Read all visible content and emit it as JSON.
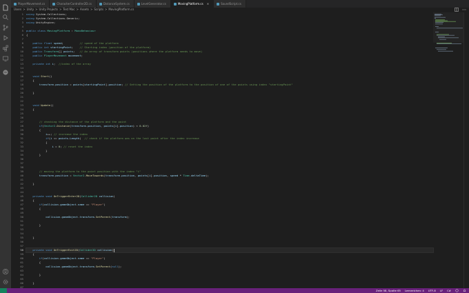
{
  "tabs": [
    {
      "label": "PlayerMovement.cs",
      "active": false
    },
    {
      "label": "CharacterController2D.cs",
      "active": false
    },
    {
      "label": "DistanceSystem.cs",
      "active": false
    },
    {
      "label": "LevelGenerator.cs",
      "active": false
    },
    {
      "label": "MovingPlatform.cs",
      "active": true,
      "close": "×"
    },
    {
      "label": "SoundScript.cs",
      "active": false
    }
  ],
  "breadcrumb": [
    "Users",
    "Unity",
    "Unity Projects",
    "Test Mac",
    "Assets",
    "Scripts",
    "MovingPlatform.cs"
  ],
  "breadcrumb_sep": ">",
  "code": {
    "current_line": 58,
    "lines": [
      [
        [
          "k",
          "using "
        ],
        [
          "t",
          "System.Collections"
        ],
        [
          "p",
          ";"
        ]
      ],
      [
        [
          "k",
          "using "
        ],
        [
          "t",
          "System.Collections.Generic"
        ],
        [
          "p",
          ";"
        ]
      ],
      [
        [
          "k",
          "using "
        ],
        [
          "t",
          "UnityEngine"
        ],
        [
          "p",
          ";"
        ]
      ],
      [],
      [
        [
          "k",
          "public class "
        ],
        [
          "c",
          "MovingPlatform"
        ],
        [
          "p",
          " : "
        ],
        [
          "c",
          "MonoBehaviour"
        ]
      ],
      [
        [
          "p",
          "{"
        ]
      ],
      [],
      [
        [
          "p",
          "    "
        ],
        [
          "k",
          "public float "
        ],
        [
          "v",
          "speed"
        ],
        [
          "p",
          ";          "
        ],
        [
          "g",
          "// speed of the platform"
        ]
      ],
      [
        [
          "p",
          "    "
        ],
        [
          "k",
          "public int "
        ],
        [
          "v",
          "startingPoint"
        ],
        [
          "p",
          ";    "
        ],
        [
          "g",
          "// Starting index (position of the platform)"
        ]
      ],
      [
        [
          "p",
          "    "
        ],
        [
          "k",
          "public "
        ],
        [
          "c",
          "Transform"
        ],
        [
          "p",
          "[] "
        ],
        [
          "v",
          "points"
        ],
        [
          "p",
          ";   "
        ],
        [
          "g",
          "// An array of transform points (positions where the platform needs to move)"
        ]
      ],
      [
        [
          "p",
          "    "
        ],
        [
          "k",
          "public "
        ],
        [
          "c",
          "PlayerMovement "
        ],
        [
          "v",
          "movement"
        ],
        [
          "p",
          ";"
        ]
      ],
      [],
      [
        [
          "p",
          "    "
        ],
        [
          "k",
          "private int "
        ],
        [
          "v",
          "i"
        ],
        [
          "p",
          ";  "
        ],
        [
          "g",
          "//index of the array"
        ]
      ],
      [],
      [],
      [
        [
          "p",
          "    "
        ],
        [
          "k",
          "void "
        ],
        [
          "f",
          "Start"
        ],
        [
          "p",
          "()"
        ]
      ],
      [
        [
          "p",
          "    {"
        ]
      ],
      [
        [
          "p",
          "        "
        ],
        [
          "v",
          "transform"
        ],
        [
          "p",
          "."
        ],
        [
          "v",
          "position"
        ],
        [
          "p",
          " = "
        ],
        [
          "v",
          "points"
        ],
        [
          "p",
          "["
        ],
        [
          "v",
          "startingPoint"
        ],
        [
          "p",
          "]."
        ],
        [
          "v",
          "position"
        ],
        [
          "p",
          "; "
        ],
        [
          "g",
          "// Setting the position of the platform to the position of one of the points using index \"startingPoint\""
        ]
      ],
      [],
      [
        [
          "p",
          "    }"
        ]
      ],
      [],
      [],
      [
        [
          "p",
          "    "
        ],
        [
          "k",
          "void "
        ],
        [
          "f",
          "Update"
        ],
        [
          "p",
          "()"
        ]
      ],
      [
        [
          "p",
          "    {"
        ]
      ],
      [],
      [],
      [
        [
          "p",
          "        "
        ],
        [
          "g",
          "// checking the distance of the platform and the point"
        ]
      ],
      [
        [
          "p",
          "        "
        ],
        [
          "k",
          "if"
        ],
        [
          "p",
          "("
        ],
        [
          "c",
          "Vector2"
        ],
        [
          "p",
          "."
        ],
        [
          "f",
          "Distance"
        ],
        [
          "p",
          "("
        ],
        [
          "v",
          "transform"
        ],
        [
          "p",
          "."
        ],
        [
          "v",
          "position"
        ],
        [
          "p",
          ", "
        ],
        [
          "v",
          "points"
        ],
        [
          "p",
          "["
        ],
        [
          "v",
          "i"
        ],
        [
          "p",
          "]."
        ],
        [
          "v",
          "position"
        ],
        [
          "p",
          ") < "
        ],
        [
          "n",
          "0.02f"
        ],
        [
          "p",
          ")"
        ]
      ],
      [
        [
          "p",
          "        {"
        ]
      ],
      [
        [
          "p",
          "            "
        ],
        [
          "v",
          "i"
        ],
        [
          "p",
          "++; "
        ],
        [
          "g",
          "// increase the index"
        ]
      ],
      [
        [
          "p",
          "            "
        ],
        [
          "k",
          "if"
        ],
        [
          "p",
          "("
        ],
        [
          "v",
          "i"
        ],
        [
          "p",
          " == "
        ],
        [
          "v",
          "points"
        ],
        [
          "p",
          "."
        ],
        [
          "v",
          "Length"
        ],
        [
          "p",
          ")  "
        ],
        [
          "g",
          "// check if the platform was on the last point after the index increase"
        ]
      ],
      [
        [
          "p",
          "            {"
        ]
      ],
      [
        [
          "p",
          "                "
        ],
        [
          "v",
          "i"
        ],
        [
          "p",
          " = "
        ],
        [
          "n",
          "0"
        ],
        [
          "p",
          "; "
        ],
        [
          "g",
          "// reset the index"
        ]
      ],
      [
        [
          "p",
          "            }"
        ]
      ],
      [
        [
          "p",
          "        }"
        ]
      ],
      [],
      [],
      [],
      [
        [
          "p",
          "        "
        ],
        [
          "g",
          "// moving the platform to the point position with the index \"i\""
        ]
      ],
      [
        [
          "p",
          "        "
        ],
        [
          "v",
          "transform"
        ],
        [
          "p",
          "."
        ],
        [
          "v",
          "position"
        ],
        [
          "p",
          " = "
        ],
        [
          "c",
          "Vector2"
        ],
        [
          "p",
          "."
        ],
        [
          "f",
          "MoveTowards"
        ],
        [
          "p",
          "("
        ],
        [
          "v",
          "transform"
        ],
        [
          "p",
          "."
        ],
        [
          "v",
          "position"
        ],
        [
          "p",
          ", "
        ],
        [
          "v",
          "points"
        ],
        [
          "p",
          "["
        ],
        [
          "v",
          "i"
        ],
        [
          "p",
          "]."
        ],
        [
          "v",
          "position"
        ],
        [
          "p",
          ", "
        ],
        [
          "v",
          "speed"
        ],
        [
          "p",
          " * "
        ],
        [
          "c",
          "Time"
        ],
        [
          "p",
          "."
        ],
        [
          "v",
          "deltaTime"
        ],
        [
          "p",
          ");"
        ]
      ],
      [],
      [
        [
          "p",
          "    }"
        ]
      ],
      [],
      [],
      [
        [
          "p",
          "    "
        ],
        [
          "k",
          "private void "
        ],
        [
          "f",
          "OnTriggerEnter2D"
        ],
        [
          "p",
          "("
        ],
        [
          "c",
          "Collider2D "
        ],
        [
          "v",
          "collision"
        ],
        [
          "p",
          ")"
        ]
      ],
      [
        [
          "p",
          "    {"
        ]
      ],
      [
        [
          "p",
          "        "
        ],
        [
          "k",
          "if"
        ],
        [
          "p",
          "("
        ],
        [
          "v",
          "collision"
        ],
        [
          "p",
          "."
        ],
        [
          "v",
          "gameObject"
        ],
        [
          "p",
          "."
        ],
        [
          "v",
          "name"
        ],
        [
          "p",
          " == "
        ],
        [
          "s",
          "\"Player\""
        ],
        [
          "p",
          ")"
        ]
      ],
      [
        [
          "p",
          "        {"
        ]
      ],
      [],
      [
        [
          "p",
          "            "
        ],
        [
          "v",
          "collision"
        ],
        [
          "p",
          "."
        ],
        [
          "v",
          "gameObject"
        ],
        [
          "p",
          "."
        ],
        [
          "v",
          "transform"
        ],
        [
          "p",
          "."
        ],
        [
          "f",
          "SetParent"
        ],
        [
          "p",
          "("
        ],
        [
          "v",
          "transform"
        ],
        [
          "p",
          ");"
        ]
      ],
      [],
      [
        [
          "p",
          "        }"
        ]
      ],
      [],
      [],
      [
        [
          "p",
          "    }"
        ]
      ],
      [],
      [],
      [
        [
          "p",
          "    "
        ],
        [
          "k",
          "private void "
        ],
        [
          "f",
          "OnTriggerExit2D"
        ],
        [
          "p",
          "("
        ],
        [
          "c",
          "Collider2D "
        ],
        [
          "v",
          "collision"
        ],
        [
          "p",
          ")"
        ]
      ],
      [
        [
          "p",
          "    {"
        ]
      ],
      [
        [
          "p",
          "        "
        ],
        [
          "k",
          "if"
        ],
        [
          "p",
          "("
        ],
        [
          "v",
          "collision"
        ],
        [
          "p",
          "."
        ],
        [
          "v",
          "gameObject"
        ],
        [
          "p",
          "."
        ],
        [
          "v",
          "name"
        ],
        [
          "p",
          " == "
        ],
        [
          "s",
          "\"Player\""
        ],
        [
          "p",
          ")"
        ]
      ],
      [
        [
          "p",
          "        {"
        ]
      ],
      [
        [
          "p",
          "            "
        ],
        [
          "v",
          "collision"
        ],
        [
          "p",
          "."
        ],
        [
          "v",
          "gameObject"
        ],
        [
          "p",
          "."
        ],
        [
          "v",
          "transform"
        ],
        [
          "p",
          "."
        ],
        [
          "f",
          "SetParent"
        ],
        [
          "p",
          "("
        ],
        [
          "k",
          "null"
        ],
        [
          "p",
          ");"
        ]
      ],
      [],
      [
        [
          "p",
          "        }"
        ]
      ],
      [],
      [
        [
          "p",
          "    }"
        ]
      ],
      [],
      [],
      [
        [
          "p",
          "}"
        ]
      ],
      [],
      []
    ]
  },
  "colors": {
    "k": "#569cd6",
    "t": "#d4d4d4",
    "c": "#4ec9b0",
    "v": "#9cdcfe",
    "f": "#dcdcaa",
    "g": "#6a9955",
    "s": "#ce9178",
    "n": "#b5cea8",
    "p": "#d4d4d4"
  },
  "status": {
    "position": "Zeile 58, Spalte 65",
    "indent": "Leerzeichen: 4",
    "encoding": "UTF-8",
    "eol": "LF",
    "language": "C#",
    "color": "#68217a"
  },
  "icons": {
    "activity": [
      "files-icon",
      "search-icon",
      "source-control-icon",
      "run-debug-icon",
      "extensions-icon",
      "remote-explorer-icon",
      "testing-icon",
      "spotify-icon",
      "account-icon",
      "settings-gear-icon"
    ],
    "tab_actions": [
      "split-editor-icon",
      "more-actions-icon"
    ],
    "status": [
      "feedback-icon",
      "notifications-bell-icon"
    ]
  }
}
